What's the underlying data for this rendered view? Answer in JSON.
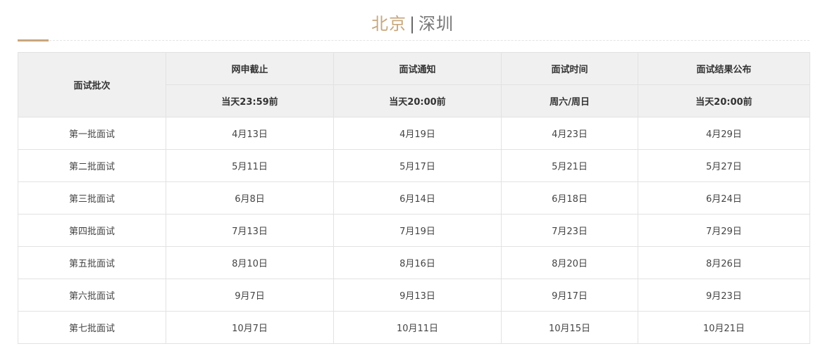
{
  "header": {
    "active_city": "北京",
    "separator": "|",
    "other_city": "深圳"
  },
  "colors": {
    "accent": "#c8a77e",
    "header_bg": "#f0f0f0",
    "border": "#e2e2e2"
  },
  "table": {
    "batch_header": "面试批次",
    "columns": [
      {
        "title": "网申截止",
        "sub": "当天23:59前"
      },
      {
        "title": "面试通知",
        "sub": "当天20:00前"
      },
      {
        "title": "面试时间",
        "sub": "周六/周日"
      },
      {
        "title": "面试结果公布",
        "sub": "当天20:00前"
      }
    ],
    "rows": [
      {
        "batch": "第一批面试",
        "cells": [
          "4月13日",
          "4月19日",
          "4月23日",
          "4月29日"
        ]
      },
      {
        "batch": "第二批面试",
        "cells": [
          "5月11日",
          "5月17日",
          "5月21日",
          "5月27日"
        ]
      },
      {
        "batch": "第三批面试",
        "cells": [
          "6月8日",
          "6月14日",
          "6月18日",
          "6月24日"
        ]
      },
      {
        "batch": "第四批面试",
        "cells": [
          "7月13日",
          "7月19日",
          "7月23日",
          "7月29日"
        ]
      },
      {
        "batch": "第五批面试",
        "cells": [
          "8月10日",
          "8月16日",
          "8月20日",
          "8月26日"
        ]
      },
      {
        "batch": "第六批面试",
        "cells": [
          "9月7日",
          "9月13日",
          "9月17日",
          "9月23日"
        ]
      },
      {
        "batch": "第七批面试",
        "cells": [
          "10月7日",
          "10月11日",
          "10月15日",
          "10月21日"
        ]
      }
    ]
  }
}
